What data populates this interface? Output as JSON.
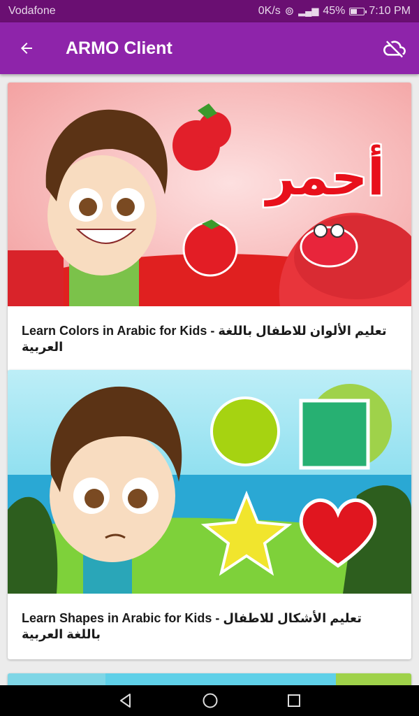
{
  "status_bar": {
    "carrier": "Vodafone",
    "net_speed": "0K/s",
    "battery_pct": "45%",
    "battery_level": 0.45,
    "time": "7:10 PM"
  },
  "app_bar": {
    "title": "ARMO Client",
    "back_icon": "arrow-left-icon",
    "cloud_icon": "cloud-off-icon",
    "color": "#8e24aa"
  },
  "videos": [
    {
      "title": "Learn Colors in Arabic for Kids - تعليم الألوان للاطفال باللغة العربية",
      "thumb_text": "أحمر"
    },
    {
      "title": "Learn Shapes in Arabic for Kids - تعليم الأشكال للاطفال باللغة العربية"
    },
    {
      "title": ""
    }
  ],
  "nav_bar": {
    "back": "triangle-back-icon",
    "home": "circle-home-icon",
    "recents": "square-recents-icon"
  }
}
